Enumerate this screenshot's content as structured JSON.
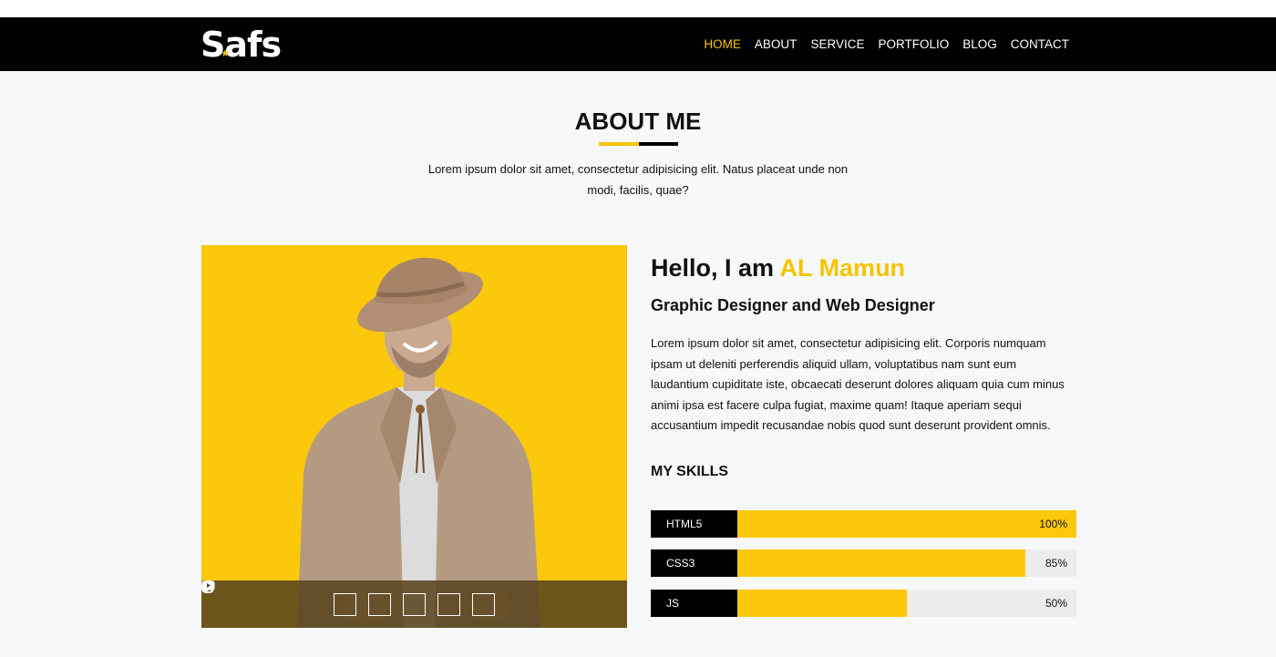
{
  "header": {
    "logo": "Safs",
    "nav": [
      "HOME",
      "ABOUT",
      "SERVICE",
      "PORTFOLIO",
      "BLOG",
      "CONTACT"
    ],
    "active_nav": "HOME"
  },
  "about": {
    "title": "ABOUT ME",
    "description": "Lorem ipsum dolor sit amet, consectetur adipisicing elit. Natus placeat unde non modi, facilis, quae?"
  },
  "profile": {
    "greeting": "Hello, I am",
    "name": "AL Mamun",
    "role": "Graphic Designer and Web Designer",
    "bio": "Lorem ipsum dolor sit amet, consectetur adipisicing elit. Corporis numquam ipsam ut deleniti perferendis aliquid ullam, voluptatibus nam sunt eum laudantium cupiditate iste, obcaecati deserunt dolores aliquam quia cum minus animi ipsa est facere culpa fugiat, maxime quam! Itaque aperiam sequi accusantium impedit recusandae nobis quod sunt deserunt provident omnis.",
    "social_icons": [
      "facebook-icon",
      "twitter-icon",
      "instagram-icon",
      "pinterest-icon",
      "youtube-icon"
    ]
  },
  "skills": {
    "title": "MY SKILLS",
    "items": [
      {
        "name": "HTML5",
        "percent_label": "100%",
        "level": 1.0
      },
      {
        "name": "CSS3",
        "percent_label": "85%",
        "level": 0.85
      },
      {
        "name": "JS",
        "percent_label": "50%",
        "level": 0.5
      }
    ]
  },
  "colors": {
    "accent": "#f7c300",
    "navbar": "#000000",
    "background": "#f7f8fa",
    "social_bar": "#5a441e"
  }
}
